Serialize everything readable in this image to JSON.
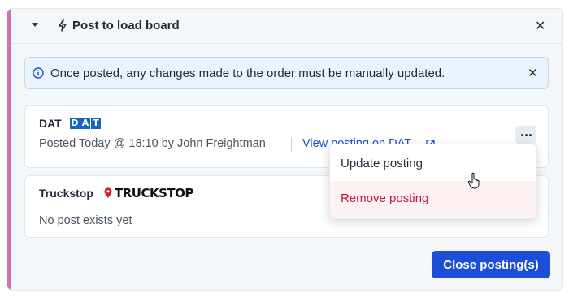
{
  "panel": {
    "title": "Post to load board",
    "accent_color": "#d36fb6",
    "icons": {
      "collapse": "caret-down-icon",
      "title": "lightning-bolt-icon",
      "close": "close-icon"
    }
  },
  "alert": {
    "icon": "info-icon",
    "text": "Once posted, any changes made to the order must be manually updated.",
    "close_icon": "close-icon"
  },
  "boards": [
    {
      "name": "DAT",
      "logo_letters": [
        "D",
        "A",
        "T"
      ],
      "posted_text": "Posted Today @ 18:10 by John Freightman",
      "link_text": "View posting on DAT",
      "link_icon": "external-link-icon",
      "more_icon": "more-horizontal-icon"
    },
    {
      "name": "Truckstop",
      "logo_text": "TRUCKSTOP",
      "logo_icon": "map-pin-icon",
      "status_text": "No post exists yet"
    }
  ],
  "menu": {
    "items": [
      {
        "label": "Update posting"
      },
      {
        "label": "Remove posting",
        "color": "#c2183a"
      }
    ]
  },
  "footer": {
    "primary_button": "Close posting(s)",
    "primary_color": "#1d4ed8"
  }
}
